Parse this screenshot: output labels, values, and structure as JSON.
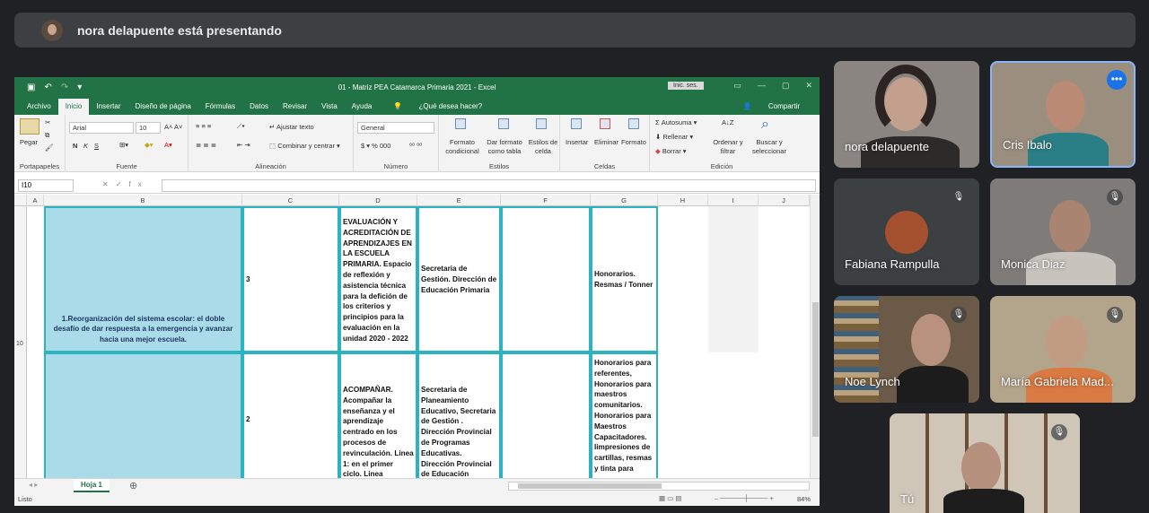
{
  "banner": {
    "presenter_text": "nora delapuente está presentando"
  },
  "excel": {
    "window_title": "01 - Matriz PEA Catamarca Primaria 2021  -  Excel",
    "sign_in": "Inic. ses.",
    "tabs": [
      "Archivo",
      "Inicio",
      "Insertar",
      "Diseño de página",
      "Fórmulas",
      "Datos",
      "Revisar",
      "Vista",
      "Ayuda",
      "¿Qué desea hacer?"
    ],
    "share": "Compartir",
    "ribbon": {
      "paste": "Pegar",
      "clipboard": "Portapapeles",
      "font_name": "Arial",
      "font_size": "10",
      "font_group": "Fuente",
      "wrap_text": "Ajustar texto",
      "merge_center": "Combinar y centrar",
      "alignment_group": "Alineación",
      "number_format": "General",
      "number_group": "Número",
      "cond_format": "Formato condicional",
      "format_table": "Dar formato como tabla",
      "cell_styles": "Estilos de celda",
      "styles_group": "Estilos",
      "insert": "Insertar",
      "delete": "Eliminar",
      "format": "Formato",
      "cells_group": "Celdas",
      "autosum": "Autosuma",
      "fill": "Rellenar",
      "clear": "Borrar",
      "sort_filter": "Ordenar y filtrar",
      "find_select": "Buscar y seleccionar",
      "editing_group": "Edición"
    },
    "name_box": "I10",
    "columns": [
      "A",
      "B",
      "C",
      "D",
      "E",
      "F",
      "G",
      "H",
      "I",
      "J"
    ],
    "rows": [
      "10"
    ],
    "cells": {
      "b10": "1.Reorganización del sistema escolar: el doble desafío de dar respuesta a la emergencia y avanzar hacia una mejor escuela.",
      "c10": "3",
      "d10": "EVALUACIÓN Y ACREDITACIÓN DE APRENDIZAJES EN LA ESCUELA PRIMARIA. Espacio de reflexión y asistencia técnica para la defición de los criterios  y principios para la evaluación en la unidad 2020 - 2022",
      "e10": "Secretaria de Gestión. Dirección de Educación Primaria",
      "g10": "Honorarios. Resmas / Tonner",
      "c11": "2",
      "d11": "ACOMPAÑAR. Acompañar la enseñanza y el aprendizaje centrado en los procesos de revinculación. Linea 1: en el primer ciclo. Linea",
      "e11": "Secretaria de Planeamiento Educativo, Secretaria de Gestión . Dirección Provincial de Programas Educativas. Dirección Provincial de Educación",
      "g11": "Honorarios para referentes, Honorarios para maestros comunitarios. Honorarios para Maestros Capacitadores. Iimpresiones de cartillas,  resmas y tinta para"
    },
    "sheet_tab": "Hoja 1",
    "status": "Listo",
    "zoom": "84%"
  },
  "participants": [
    {
      "name": "nora delapuente"
    },
    {
      "name": "Cris Ibalo"
    },
    {
      "name": "Fabiana Rampulla"
    },
    {
      "name": "Monica Diaz"
    },
    {
      "name": "Noe Lynch"
    },
    {
      "name": "María Gabriela Mad..."
    },
    {
      "name": "Tú"
    }
  ],
  "colors": {
    "excel_green": "#217346",
    "cell_fill": "#a9dbe8",
    "border_teal": "#2bb3c0",
    "meet_bg": "#202124",
    "active_speaker": "#8ab4f8"
  }
}
